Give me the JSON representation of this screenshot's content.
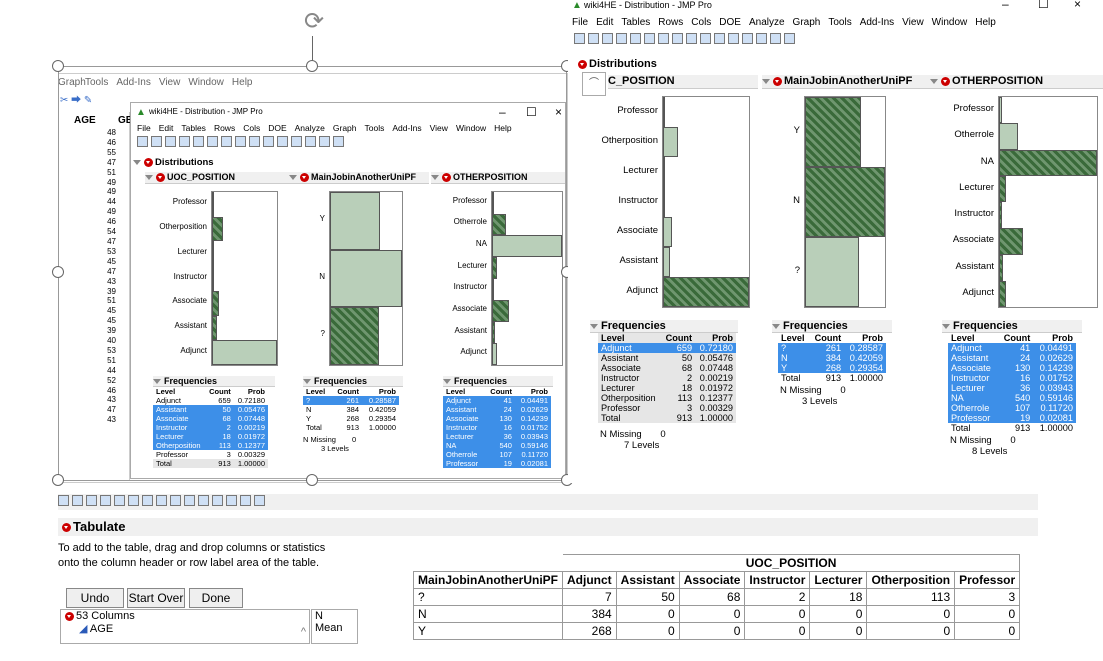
{
  "small_window": {
    "title": "wiki4HE - Distribution - JMP Pro",
    "menu": [
      "File",
      "Edit",
      "Tables",
      "Rows",
      "Cols",
      "DOE",
      "Analyze",
      "Graph",
      "Tools",
      "Add-Ins",
      "View",
      "Window",
      "Help"
    ],
    "distributions_label": "Distributions",
    "uoc": {
      "header": "UOC_POSITION",
      "levels": [
        "Professor",
        "Otherposition",
        "Lecturer",
        "Instructor",
        "Associate",
        "Assistant",
        "Adjunct"
      ],
      "bars": [
        {
          "v": 3,
          "sel": false
        },
        {
          "v": 113,
          "sel": true
        },
        {
          "v": 18,
          "sel": true
        },
        {
          "v": 2,
          "sel": true
        },
        {
          "v": 68,
          "sel": true
        },
        {
          "v": 50,
          "sel": true
        },
        {
          "v": 659,
          "sel": false
        }
      ]
    },
    "mjob": {
      "header": "MainJobinAnotherUniPF",
      "levels": [
        "Y",
        "N",
        "?"
      ],
      "bars": [
        {
          "v": 268,
          "sel": false
        },
        {
          "v": 384,
          "sel": false
        },
        {
          "v": 261,
          "sel": true
        }
      ]
    },
    "other": {
      "header": "OTHERPOSITION",
      "levels": [
        "Professor",
        "Otherrole",
        "NA",
        "Lecturer",
        "Instructor",
        "Associate",
        "Assistant",
        "Adjunct"
      ],
      "bars": [
        {
          "v": 19,
          "sel": true
        },
        {
          "v": 107,
          "sel": true
        },
        {
          "v": 540,
          "sel": false
        },
        {
          "v": 36,
          "sel": true
        },
        {
          "v": 16,
          "sel": true
        },
        {
          "v": 130,
          "sel": true
        },
        {
          "v": 24,
          "sel": true
        },
        {
          "v": 41,
          "sel": false
        }
      ]
    },
    "freq_label": "Frequencies",
    "freq_cols": [
      "Level",
      "Count",
      "Prob"
    ],
    "freq1": [
      [
        "Adjunct",
        "659",
        "0.72180",
        "n"
      ],
      [
        "Assistant",
        "50",
        "0.05476",
        "s"
      ],
      [
        "Associate",
        "68",
        "0.07448",
        "s"
      ],
      [
        "Instructor",
        "2",
        "0.00219",
        "s"
      ],
      [
        "Lecturer",
        "18",
        "0.01972",
        "s"
      ],
      [
        "Otherposition",
        "113",
        "0.12377",
        "s"
      ],
      [
        "Professor",
        "3",
        "0.00329",
        "n"
      ],
      [
        "Total",
        "913",
        "1.00000",
        "t"
      ]
    ],
    "freq2": [
      [
        "?",
        "261",
        "0.28587",
        "s"
      ],
      [
        "N",
        "384",
        "0.42059",
        "n"
      ],
      [
        "Y",
        "268",
        "0.29354",
        "n"
      ],
      [
        "Total",
        "913",
        "1.00000",
        "n"
      ]
    ],
    "freq2_missing": "N Missing",
    "freq2_missing_val": "0",
    "freq2_levels": "3 Levels",
    "freq3": [
      [
        "Adjunct",
        "41",
        "0.04491",
        "s"
      ],
      [
        "Assistant",
        "24",
        "0.02629",
        "s"
      ],
      [
        "Associate",
        "130",
        "0.14239",
        "s"
      ],
      [
        "Instructor",
        "16",
        "0.01752",
        "s"
      ],
      [
        "Lecturer",
        "36",
        "0.03943",
        "s"
      ],
      [
        "NA",
        "540",
        "0.59146",
        "s"
      ],
      [
        "Otherrole",
        "107",
        "0.11720",
        "s"
      ],
      [
        "Professor",
        "19",
        "0.02081",
        "s"
      ]
    ]
  },
  "back_window": {
    "menu": [
      "Graph",
      "Tools",
      "Add-Ins",
      "View",
      "Window",
      "Help"
    ],
    "col_headers": [
      "AGE",
      "GE"
    ],
    "ages": [
      "48",
      "46",
      "55",
      "47",
      "51",
      "49",
      "49",
      "44",
      "49",
      "46",
      "54",
      "47",
      "53",
      "45",
      "47",
      "43",
      "39",
      "51",
      "45",
      "45",
      "39",
      "40",
      "53",
      "51",
      "44",
      "52",
      "46",
      "43",
      "47",
      "43"
    ]
  },
  "big_window": {
    "title": "wiki4HE - Distribution - JMP Pro",
    "menu": [
      "File",
      "Edit",
      "Tables",
      "Rows",
      "Cols",
      "DOE",
      "Analyze",
      "Graph",
      "Tools",
      "Add-Ins",
      "View",
      "Window",
      "Help"
    ],
    "distributions_label": "Distributions",
    "uoc_header": "C_POSITION",
    "mjob_header": "MainJobinAnotherUniPF",
    "other_header": "OTHERPOSITION",
    "uoc_levels": [
      "Professor",
      "Otherposition",
      "Lecturer",
      "Instructor",
      "Associate",
      "Assistant",
      "Adjunct"
    ],
    "mjob_levels": [
      "Y",
      "N",
      "?"
    ],
    "other_levels": [
      "Professor",
      "Otherrole",
      "NA",
      "Lecturer",
      "Instructor",
      "Associate",
      "Assistant",
      "Adjunct"
    ],
    "freq1": [
      [
        "Adjunct",
        "659",
        "0.72180",
        "s"
      ],
      [
        "Assistant",
        "50",
        "0.05476",
        "n"
      ],
      [
        "Associate",
        "68",
        "0.07448",
        "n"
      ],
      [
        "Instructor",
        "2",
        "0.00219",
        "n"
      ],
      [
        "Lecturer",
        "18",
        "0.01972",
        "n"
      ],
      [
        "Otherposition",
        "113",
        "0.12377",
        "n"
      ],
      [
        "Professor",
        "3",
        "0.00329",
        "n"
      ],
      [
        "Total",
        "913",
        "1.00000",
        "n"
      ]
    ],
    "freq1_missing": "N Missing",
    "freq1_missing_val": "0",
    "freq1_levels": "7 Levels",
    "freq2": [
      [
        "?",
        "261",
        "0.28587",
        "s"
      ],
      [
        "N",
        "384",
        "0.42059",
        "s"
      ],
      [
        "Y",
        "268",
        "0.29354",
        "s"
      ],
      [
        "Total",
        "913",
        "1.00000",
        "n"
      ]
    ],
    "freq2_levels": "3 Levels",
    "freq3": [
      [
        "Adjunct",
        "41",
        "0.04491",
        "s"
      ],
      [
        "Assistant",
        "24",
        "0.02629",
        "s"
      ],
      [
        "Associate",
        "130",
        "0.14239",
        "s"
      ],
      [
        "Instructor",
        "16",
        "0.01752",
        "s"
      ],
      [
        "Lecturer",
        "36",
        "0.03943",
        "s"
      ],
      [
        "NA",
        "540",
        "0.59146",
        "s"
      ],
      [
        "Otherrole",
        "107",
        "0.11720",
        "s"
      ],
      [
        "Professor",
        "19",
        "0.02081",
        "s"
      ],
      [
        "Total",
        "913",
        "1.00000",
        "n"
      ]
    ],
    "freq3_levels": "8 Levels"
  },
  "tabulate": {
    "title": "Tabulate",
    "instructions_1": "To add to the table, drag and drop columns or statistics",
    "instructions_2": "onto the column header or row label area of the table.",
    "undo": "Undo",
    "start_over": "Start Over",
    "done": "Done",
    "columns_label": "53 Columns",
    "first_col": "AGE",
    "stats": [
      "N",
      "Mean"
    ],
    "table": {
      "group_header": "UOC_POSITION",
      "row_header": "MainJobinAnotherUniPF",
      "cols": [
        "Adjunct",
        "Assistant",
        "Associate",
        "Instructor",
        "Lecturer",
        "Otherposition",
        "Professor"
      ],
      "rows": [
        [
          "?",
          "7",
          "50",
          "68",
          "2",
          "18",
          "113",
          "3"
        ],
        [
          "N",
          "384",
          "0",
          "0",
          "0",
          "0",
          "0",
          "0"
        ],
        [
          "Y",
          "268",
          "0",
          "0",
          "0",
          "0",
          "0",
          "0"
        ]
      ]
    }
  },
  "colors": {
    "selected": "#3d8fe8",
    "bar_fill": "#b9cfb9",
    "bar_hatch": "#3a6a3a",
    "red_triangle": "#cc0000"
  }
}
